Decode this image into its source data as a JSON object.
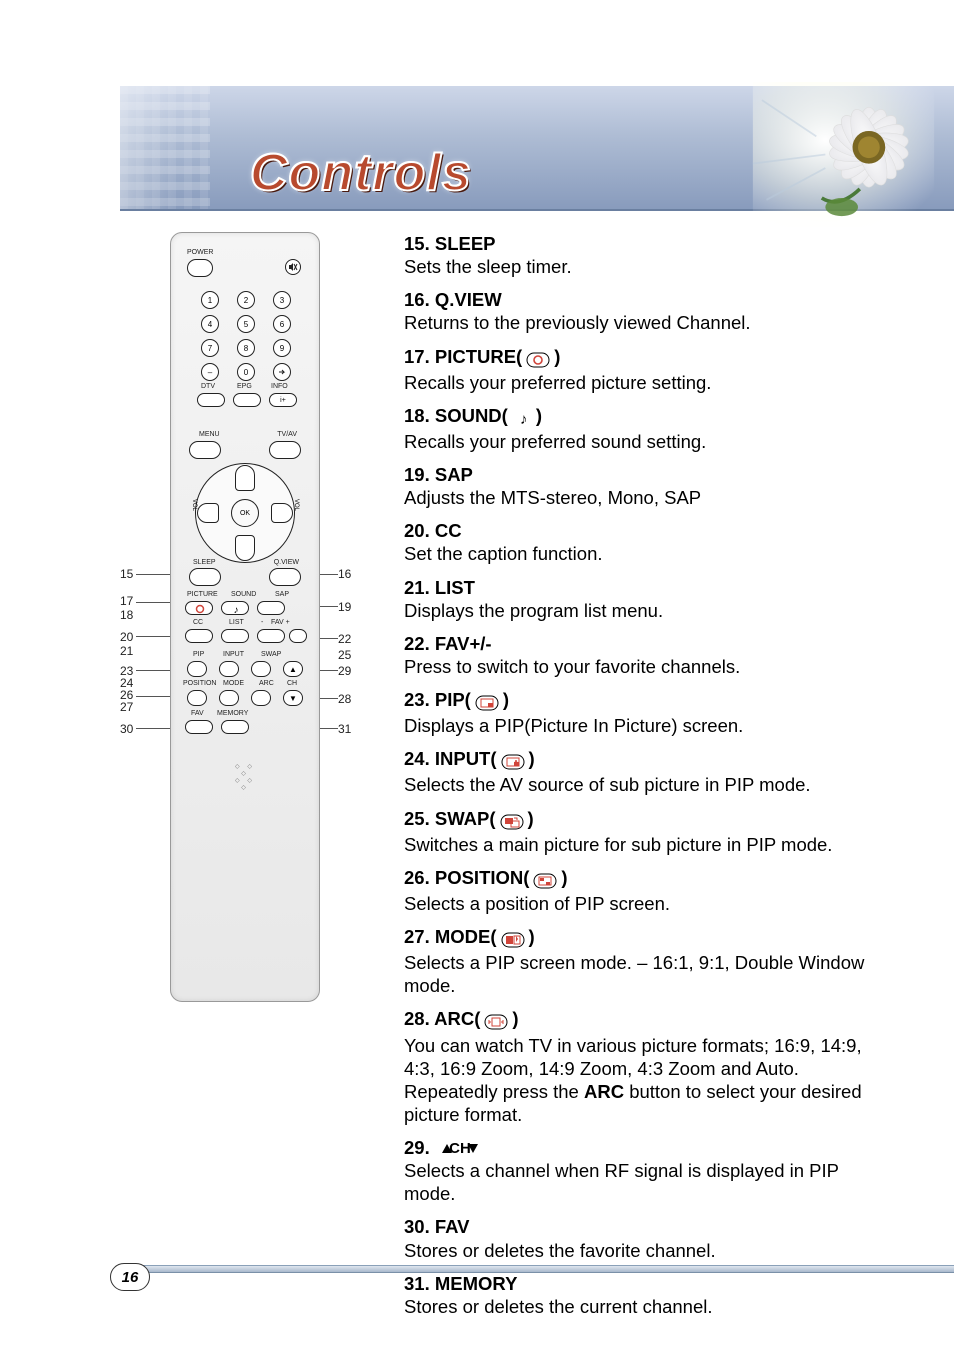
{
  "page": {
    "title": "Controls",
    "number": "16"
  },
  "remote": {
    "labels": {
      "power": "POWER",
      "mute": "",
      "dtv": "DTV",
      "epg": "EPG",
      "info": "INFO",
      "iplus": "i+",
      "menu": "MENU",
      "tvav": "TV/AV",
      "ok": "OK",
      "vol_l": "VOL",
      "vol_r": "VOL",
      "sleep": "SLEEP",
      "qview": "Q.VIEW",
      "picture": "PICTURE",
      "sound": "SOUND",
      "sap": "SAP",
      "cc": "CC",
      "list": "LIST",
      "fav": "FAV +",
      "favminus": "-",
      "pip": "PIP",
      "input": "INPUT",
      "swap": "SWAP",
      "position": "POSITION",
      "mode": "MODE",
      "arc": "ARC",
      "ch": "CH",
      "fav2": "FAV",
      "memory": "MEMORY"
    },
    "callouts": {
      "c15": "15",
      "c16": "16",
      "c17": "17",
      "c18": "18",
      "c19": "19",
      "c20": "20",
      "c21": "21",
      "c22": "22",
      "c23": "23",
      "c24": "24",
      "c25": "25",
      "c26": "26",
      "c27": "27",
      "c28": "28",
      "c29": "29",
      "c30": "30",
      "c31": "31"
    }
  },
  "items": [
    {
      "num": "15.",
      "name": "SLEEP",
      "icon": null,
      "desc": [
        "Sets the sleep timer."
      ]
    },
    {
      "num": "16.",
      "name": "Q.VIEW",
      "icon": null,
      "desc": [
        "Returns to the previously viewed Channel."
      ]
    },
    {
      "num": "17.",
      "name": "PICTURE(",
      "icon": "circle",
      "tail": ")",
      "desc": [
        "Recalls your preferred picture setting."
      ]
    },
    {
      "num": "18.",
      "name": "SOUND(",
      "icon": "note",
      "tail": ")",
      "desc": [
        "Recalls your preferred sound setting."
      ]
    },
    {
      "num": "19.",
      "name": "SAP",
      "icon": null,
      "desc": [
        "Adjusts the MTS-stereo, Mono, SAP"
      ]
    },
    {
      "num": "20.",
      "name": "CC",
      "icon": null,
      "desc": [
        "Set the caption function."
      ]
    },
    {
      "num": "21.",
      "name": "LIST",
      "icon": null,
      "desc": [
        "Displays the program list menu."
      ]
    },
    {
      "num": "22.",
      "name": "FAV+/-",
      "icon": null,
      "desc": [
        "Press to switch to your favorite channels."
      ]
    },
    {
      "num": "23.",
      "name": "PIP(",
      "icon": "pip",
      "tail": ")",
      "desc": [
        "Displays a PIP(Picture In Picture) screen."
      ]
    },
    {
      "num": "24.",
      "name": "INPUT(",
      "icon": "input",
      "tail": ")",
      "desc": [
        "Selects the AV source of sub picture in PIP mode."
      ]
    },
    {
      "num": "25.",
      "name": "SWAP(",
      "icon": "swap",
      "tail": ")",
      "desc": [
        "Switches a main picture for sub picture in PIP mode."
      ]
    },
    {
      "num": "26.",
      "name": "POSITION(",
      "icon": "position",
      "tail": ")",
      "desc": [
        "Selects a position of PIP screen."
      ]
    },
    {
      "num": "27.",
      "name": "MODE(",
      "icon": "mode",
      "tail": ")",
      "desc": [
        "Selects a PIP screen mode. – 16:1, 9:1, Double Window mode."
      ]
    },
    {
      "num": "28.",
      "name": "ARC(",
      "icon": "arc",
      "tail": ")",
      "desc": [
        "You can watch TV in various picture formats; 16:9, 14:9, 4:3, 16:9 Zoom, 14:9 Zoom, 4:3 Zoom and Auto.",
        "Repeatedly press the <b>ARC</b> button to select your desired picture format."
      ]
    },
    {
      "num": "29.",
      "name": "",
      "icon": "ch",
      "namemid": "CH",
      "tail": "",
      "desc": [
        "Selects a channel when RF signal is displayed in PIP mode."
      ]
    },
    {
      "num": "30.",
      "name": "FAV",
      "icon": null,
      "desc": [
        "Stores or deletes the favorite channel."
      ]
    },
    {
      "num": "31.",
      "name": "MEMORY",
      "icon": null,
      "desc": [
        "Stores or deletes the current channel."
      ]
    }
  ]
}
